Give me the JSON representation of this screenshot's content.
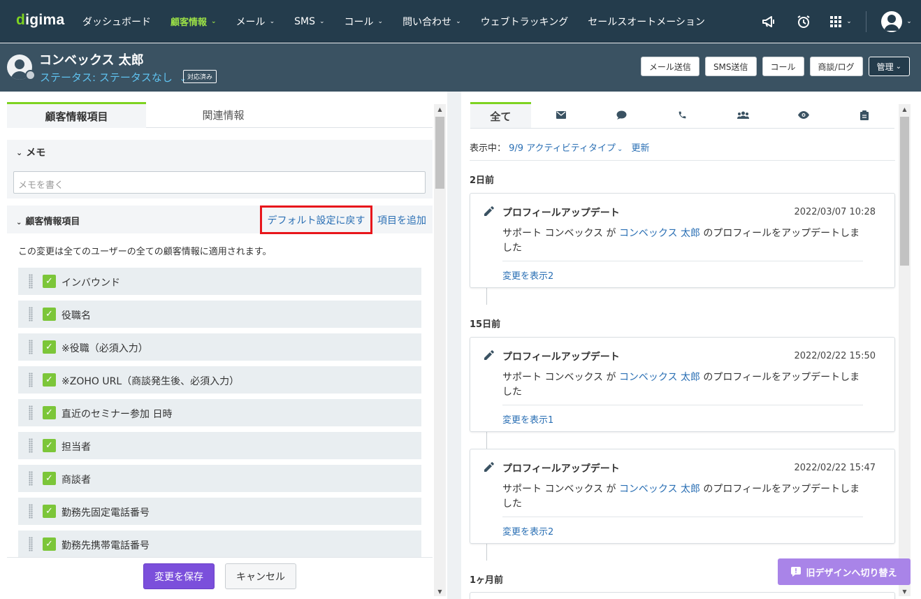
{
  "app": {
    "logo": "digima"
  },
  "nav": {
    "items": [
      {
        "label": "ダッシュボード",
        "caret": false,
        "active": false
      },
      {
        "label": "顧客情報",
        "caret": true,
        "active": true
      },
      {
        "label": "メール",
        "caret": true,
        "active": false
      },
      {
        "label": "SMS",
        "caret": true,
        "active": false
      },
      {
        "label": "コール",
        "caret": true,
        "active": false
      },
      {
        "label": "問い合わせ",
        "caret": true,
        "active": false
      },
      {
        "label": "ウェブトラッキング",
        "caret": false,
        "active": false
      },
      {
        "label": "セールスオートメーション",
        "caret": false,
        "active": false
      }
    ],
    "right_icons": [
      "megaphone-icon",
      "alarm-clock-icon",
      "apps-grid-icon",
      "user-avatar-icon"
    ]
  },
  "customer": {
    "name": "コンベックス 太郎",
    "status": "ステータス: ステータスなし",
    "badge": "対応済み",
    "buttons": {
      "email": "メール送信",
      "sms": "SMS送信",
      "call": "コール",
      "meeting": "商談/ログ",
      "manage": "管理"
    }
  },
  "left": {
    "tabs": {
      "fields": "顧客情報項目",
      "related": "関連情報"
    },
    "memo": {
      "title": "メモ",
      "placeholder": "メモを書く"
    },
    "fields_section": {
      "title": "顧客情報項目",
      "reset": "デフォルト設定に戻す",
      "add": "項目を追加",
      "note": "この変更は全てのユーザーの全ての顧客情報に適用されます。"
    },
    "fields": [
      {
        "label": "インバウンド",
        "checked": true
      },
      {
        "label": "役職名",
        "checked": true
      },
      {
        "label": "※役職（必須入力）",
        "checked": true
      },
      {
        "label": "※ZOHO URL（商談発生後、必須入力）",
        "checked": true
      },
      {
        "label": "直近のセミナー参加 日時",
        "checked": true
      },
      {
        "label": "担当者",
        "checked": true
      },
      {
        "label": "商談者",
        "checked": true
      },
      {
        "label": "勤務先固定電話番号",
        "checked": true
      },
      {
        "label": "勤務先携帯電話番号",
        "checked": true
      }
    ],
    "save": "変更を保存",
    "cancel": "キャンセル"
  },
  "right": {
    "tabs": {
      "all": "全て",
      "icons": [
        "envelope-icon",
        "chat-bubble-icon",
        "phone-icon",
        "group-icon",
        "eye-icon",
        "clipboard-icon"
      ]
    },
    "showing_prefix": "表示中：",
    "showing_filter": "9/9 アクティビティタイプ",
    "refresh": "更新",
    "groups": [
      {
        "label": "2日前",
        "activities": [
          {
            "title": "プロフィールアップデート",
            "time": "2022/03/07 10:28",
            "actor": "サポート コンベックス が ",
            "target": "コンベックス 太郎",
            "action": " のプロフィールをアップデートしました",
            "link": "変更を表示2"
          }
        ]
      },
      {
        "label": "15日前",
        "activities": [
          {
            "title": "プロフィールアップデート",
            "time": "2022/02/22 15:50",
            "actor": "サポート コンベックス が ",
            "target": "コンベックス 太郎",
            "action": " のプロフィールをアップデートしました",
            "link": "変更を表示1"
          },
          {
            "title": "プロフィールアップデート",
            "time": "2022/02/22 15:47",
            "actor": "サポート コンベックス が ",
            "target": "コンベックス 太郎",
            "action": " のプロフィールをアップデートしました",
            "link": "変更を表示2"
          }
        ]
      },
      {
        "label": "1ヶ月前",
        "activities": []
      }
    ]
  },
  "legacy_button": "旧デザインへ切り替え"
}
